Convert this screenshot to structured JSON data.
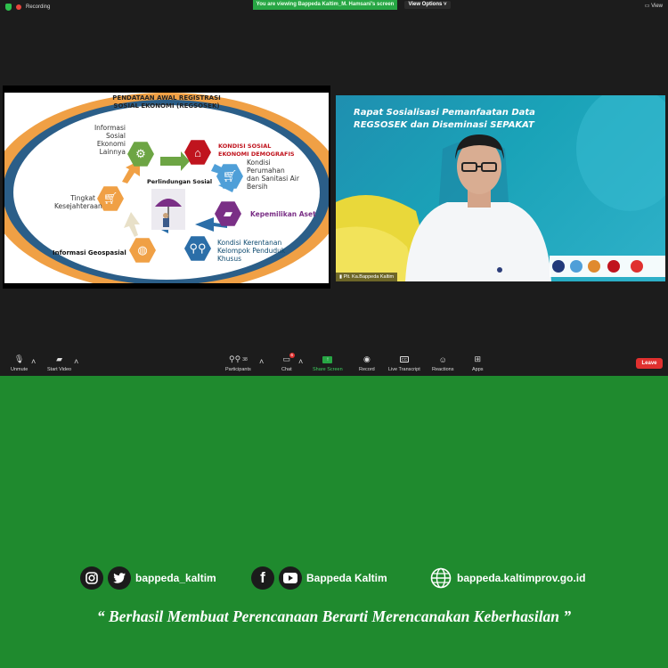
{
  "topbar": {
    "recording_label": "Recording",
    "viewing_banner": "You are viewing Bappeda Kaltim_M. Hamsani's screen",
    "view_options_label": "View Options ˅",
    "view_label": "View"
  },
  "slide": {
    "title_line1": "PENDATAAN AWAL REGISTRASI",
    "title_line2": "SOSIAL EKONOMI (REGSOSEK)",
    "center_label": "Perlindungan Sosial",
    "labels": {
      "info_sosial_1": "Informasi",
      "info_sosial_2": "Sosial",
      "info_sosial_3": "Ekonomi",
      "info_sosial_4": "Lainnya",
      "kondisi_sosial_1": "KONDISI SOSIAL",
      "kondisi_sosial_2": "EKONOMI DEMOGRAFIS",
      "perumahan_1": "Kondisi",
      "perumahan_2": "Perumahan",
      "perumahan_3": "dan Sanitasi Air",
      "perumahan_4": "Bersih",
      "aset": "Kepemilikan Aset",
      "kerentanan_1": "Kondisi Kerentanan",
      "kerentanan_2": "Kelompok Penduduk",
      "kerentanan_3": "Khusus",
      "geospasial": "Informasi Geospasial",
      "kesejahteraan_1": "Tingkat",
      "kesejahteraan_2": "Kesejahteraan"
    }
  },
  "camera": {
    "title_line1": "Rapat Sosialisasi Pemanfaatan Data",
    "title_line2": "REGSOSEK dan Diseminasi SEPAKAT",
    "participant_name": "Plt. Ka.Bappeda Kaltim"
  },
  "toolbar": {
    "unmute": "Unmute",
    "start_video": "Start Video",
    "participants": "Participants",
    "participants_count": "38",
    "chat": "Chat",
    "chat_badge": "6",
    "share_screen": "Share Screen",
    "record": "Record",
    "live_transcript": "Live Transcript",
    "cc": "CC",
    "reactions": "Reactions",
    "apps": "Apps",
    "leave": "Leave"
  },
  "footer": {
    "instagram_handle": "bappeda_kaltim",
    "facebook_youtube_name": "Bappeda Kaltim",
    "website": "bappeda.kaltimprov.go.id",
    "tagline": "“ Berhasil  Membuat Perencanaan Berarti Merencanakan Keberhasilan ”"
  },
  "colors": {
    "background_green": "#1f8a2e",
    "zoom_dark": "#1c1c1c",
    "banner_green": "#27a644",
    "leave_red": "#e0302f"
  }
}
